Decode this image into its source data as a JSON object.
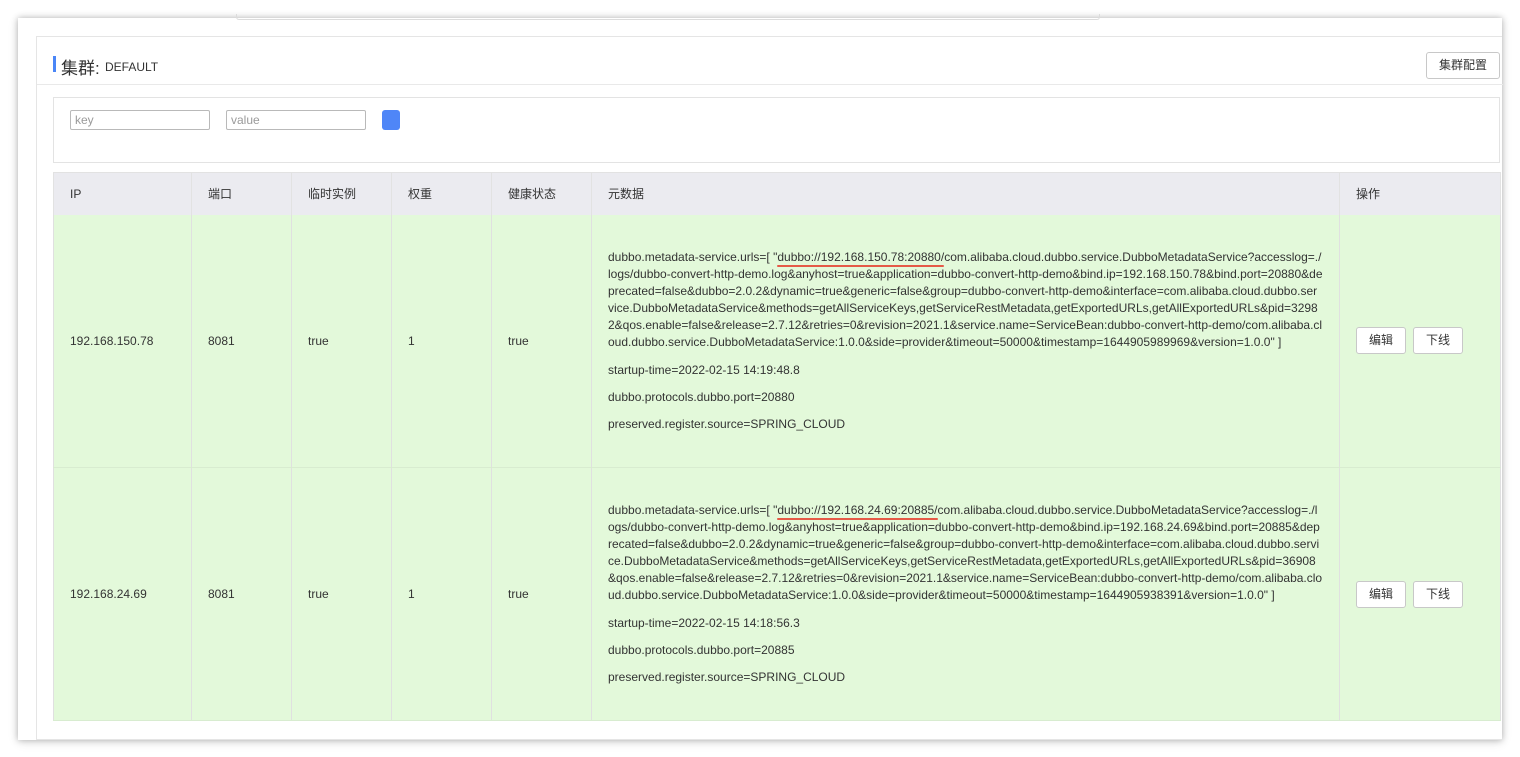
{
  "cluster": {
    "title": "集群:",
    "name": "DEFAULT",
    "config_button": "集群配置"
  },
  "filter": {
    "key_placeholder": "key",
    "value_placeholder": "value"
  },
  "colors": {
    "accent": "#4a86f7",
    "row_background": "#e3f9da",
    "header_background": "#ebebf0",
    "highlight_underline": "#e55a47"
  },
  "table": {
    "headers": [
      "IP",
      "端口",
      "临时实例",
      "权重",
      "健康状态",
      "元数据",
      "操作"
    ],
    "rows": [
      {
        "ip": "192.168.150.78",
        "port": "8081",
        "ephemeral": "true",
        "weight": "1",
        "healthy": "true",
        "metadata": {
          "urls_prefix": "dubbo.metadata-service.urls=[ \"",
          "urls_highlight": "dubbo://192.168.150.78:20880/",
          "urls_rest": "com.alibaba.cloud.dubbo.service.DubboMetadataService?accesslog=./logs/dubbo-convert-http-demo.log&anyhost=true&application=dubbo-convert-http-demo&bind.ip=192.168.150.78&bind.port=20880&deprecated=false&dubbo=2.0.2&dynamic=true&generic=false&group=dubbo-convert-http-demo&interface=com.alibaba.cloud.dubbo.service.DubboMetadataService&methods=getAllServiceKeys,getServiceRestMetadata,getExportedURLs,getAllExportedURLs&pid=32982&qos.enable=false&release=2.7.12&retries=0&revision=2021.1&service.name=ServiceBean:dubbo-convert-http-demo/com.alibaba.cloud.dubbo.service.DubboMetadataService:1.0.0&side=provider&timeout=50000&timestamp=1644905989969&version=1.0.0\" ]",
          "startup_time": "startup-time=2022-02-15 14:19:48.8",
          "protocol_port": "dubbo.protocols.dubbo.port=20880",
          "register_source": "preserved.register.source=SPRING_CLOUD"
        },
        "edit_label": "编辑",
        "offline_label": "下线"
      },
      {
        "ip": "192.168.24.69",
        "port": "8081",
        "ephemeral": "true",
        "weight": "1",
        "healthy": "true",
        "metadata": {
          "urls_prefix": "dubbo.metadata-service.urls=[ \"",
          "urls_highlight": "dubbo://192.168.24.69:20885/",
          "urls_rest": "com.alibaba.cloud.dubbo.service.DubboMetadataService?accesslog=./logs/dubbo-convert-http-demo.log&anyhost=true&application=dubbo-convert-http-demo&bind.ip=192.168.24.69&bind.port=20885&deprecated=false&dubbo=2.0.2&dynamic=true&generic=false&group=dubbo-convert-http-demo&interface=com.alibaba.cloud.dubbo.service.DubboMetadataService&methods=getAllServiceKeys,getServiceRestMetadata,getExportedURLs,getAllExportedURLs&pid=36908&qos.enable=false&release=2.7.12&retries=0&revision=2021.1&service.name=ServiceBean:dubbo-convert-http-demo/com.alibaba.cloud.dubbo.service.DubboMetadataService:1.0.0&side=provider&timeout=50000&timestamp=1644905938391&version=1.0.0\" ]",
          "startup_time": "startup-time=2022-02-15 14:18:56.3",
          "protocol_port": "dubbo.protocols.dubbo.port=20885",
          "register_source": "preserved.register.source=SPRING_CLOUD"
        },
        "edit_label": "编辑",
        "offline_label": "下线"
      }
    ]
  }
}
